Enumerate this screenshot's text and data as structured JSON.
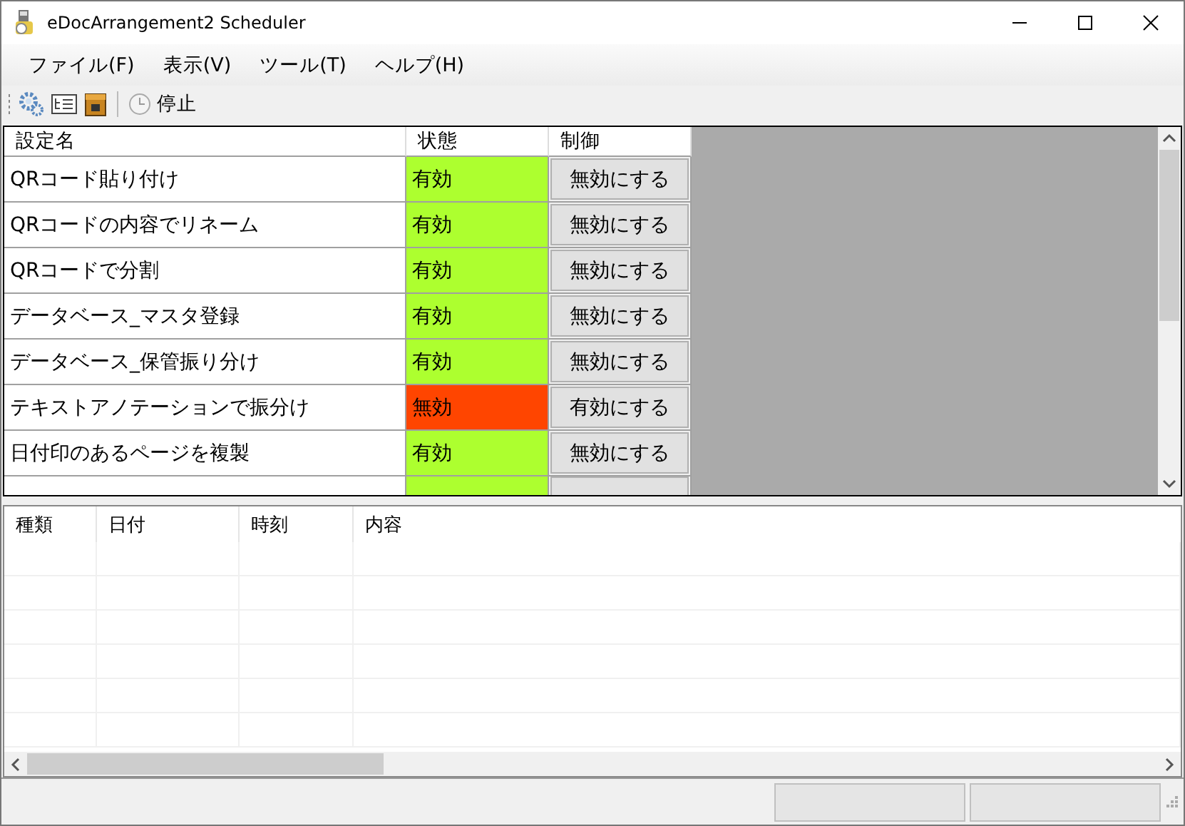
{
  "window": {
    "title": "eDocArrangement2 Scheduler"
  },
  "menu": [
    "ファイル(F)",
    "表示(V)",
    "ツール(T)",
    "ヘルプ(H)"
  ],
  "toolbar": {
    "stop_label": "停止"
  },
  "grid": {
    "columns": [
      "設定名",
      "状態",
      "制御"
    ],
    "rows": [
      {
        "name": "QRコード貼り付け",
        "status": "有効",
        "enabled": true,
        "action": "無効にする"
      },
      {
        "name": "QRコードの内容でリネーム",
        "status": "有効",
        "enabled": true,
        "action": "無効にする"
      },
      {
        "name": "QRコードで分割",
        "status": "有効",
        "enabled": true,
        "action": "無効にする"
      },
      {
        "name": "データベース_マスタ登録",
        "status": "有効",
        "enabled": true,
        "action": "無効にする"
      },
      {
        "name": "データベース_保管振り分け",
        "status": "有効",
        "enabled": true,
        "action": "無効にする"
      },
      {
        "name": "テキストアノテーションで振分け",
        "status": "無効",
        "enabled": false,
        "action": "有効にする"
      },
      {
        "name": "日付印のあるページを複製",
        "status": "有効",
        "enabled": true,
        "action": "無効にする"
      },
      {
        "enabled": true
      }
    ]
  },
  "log": {
    "columns": [
      "種類",
      "日付",
      "時刻",
      "内容"
    ]
  }
}
